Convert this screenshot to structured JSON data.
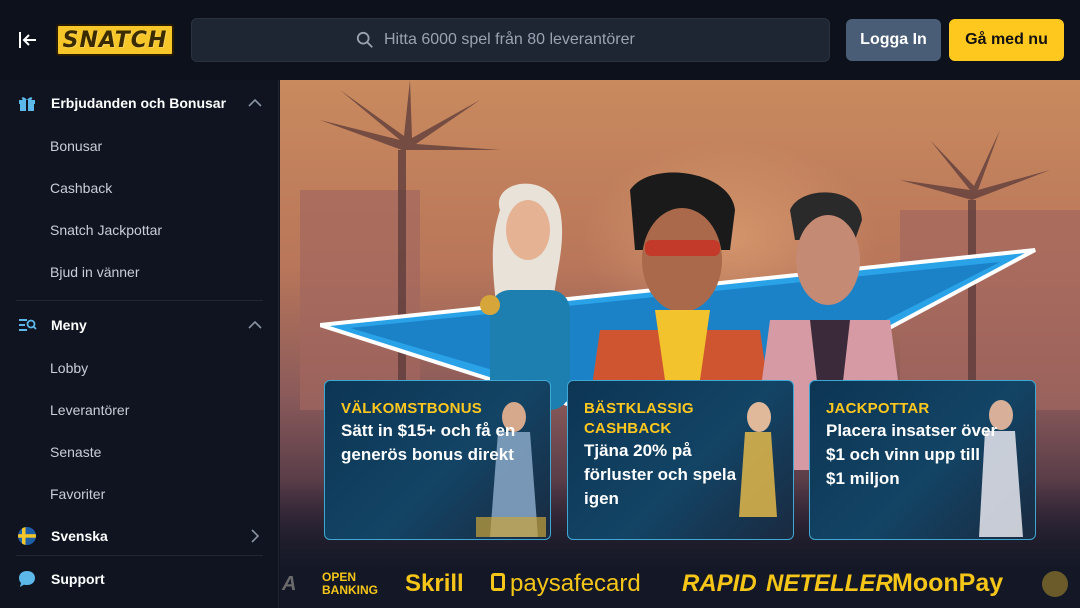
{
  "header": {
    "brand": "SNATCH",
    "search_placeholder": "Hitta 6000 spel från 80 leverantörer",
    "login_label": "Logga In",
    "join_label": "Gå med nu"
  },
  "sidebar": {
    "offers": {
      "title": "Erbjudanden och Bonusar",
      "items": [
        "Bonusar",
        "Cashback",
        "Snatch Jackpottar",
        "Bjud in vänner"
      ]
    },
    "menu": {
      "title": "Meny",
      "items": [
        "Lobby",
        "Leverantörer",
        "Senaste",
        "Favoriter"
      ]
    },
    "language": "Svenska",
    "support": "Support"
  },
  "promos": [
    {
      "tag": "VÄLKOMSTBONUS",
      "desc": "Sätt in $15+ och få en generös bonus direkt"
    },
    {
      "tag": "BÄSTKLASSIG CASHBACK",
      "desc": "Tjäna 20% på förluster och spela igen"
    },
    {
      "tag": "JACKPOTTAR",
      "desc": "Placera insatser över $1 och vinn upp till $1 miljon"
    }
  ],
  "payments": {
    "partial_left": "A",
    "open_banking_1": "OPEN",
    "open_banking_2": "BANKING",
    "skrill": "Skrill",
    "paysafecard": "paysafecard",
    "rapid": "RAPID",
    "neteller": "NETELLER",
    "moonpay": "MoonPay"
  },
  "colors": {
    "accent": "#ffc81e",
    "login_bg": "#4a5d77",
    "sidebar_bg": "#0f1420",
    "promo_border": "#3fa7d4"
  }
}
